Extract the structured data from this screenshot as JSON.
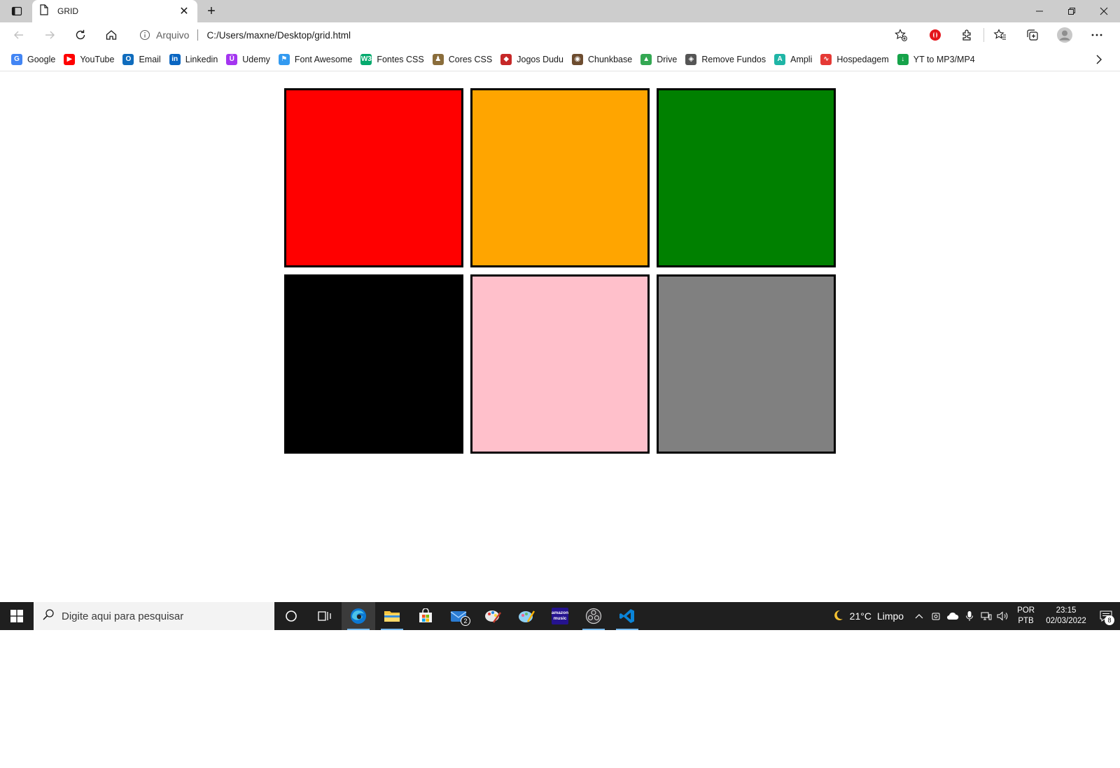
{
  "tab": {
    "title": "GRID"
  },
  "address": {
    "origin_label": "Arquivo",
    "url": "C:/Users/maxne/Desktop/grid.html"
  },
  "bookmarks": [
    {
      "label": "Google",
      "icon": "google-icon",
      "color": "#4285f4",
      "glyph": "G"
    },
    {
      "label": "YouTube",
      "icon": "youtube-icon",
      "color": "#ff0000",
      "glyph": "▶"
    },
    {
      "label": "Email",
      "icon": "outlook-icon",
      "color": "#0f6cbd",
      "glyph": "O"
    },
    {
      "label": "Linkedin",
      "icon": "linkedin-icon",
      "color": "#0a66c2",
      "glyph": "in"
    },
    {
      "label": "Udemy",
      "icon": "udemy-icon",
      "color": "#a435f0",
      "glyph": "Ü"
    },
    {
      "label": "Font Awesome",
      "icon": "flag-icon",
      "color": "#339af0",
      "glyph": "⚑"
    },
    {
      "label": "Fontes CSS",
      "icon": "w3schools-icon",
      "color": "#04aa6d",
      "glyph": "W3"
    },
    {
      "label": "Cores CSS",
      "icon": "paint-icon",
      "color": "#8a6d3b",
      "glyph": "♟"
    },
    {
      "label": "Jogos Dudu",
      "icon": "game-icon",
      "color": "#c62828",
      "glyph": "◆"
    },
    {
      "label": "Chunkbase",
      "icon": "chunkbase-icon",
      "color": "#6d4c2f",
      "glyph": "◉"
    },
    {
      "label": "Drive",
      "icon": "drive-icon",
      "color": "#34a853",
      "glyph": "▲"
    },
    {
      "label": "Remove Fundos",
      "icon": "removebg-icon",
      "color": "#555555",
      "glyph": "◈"
    },
    {
      "label": "Ampli",
      "icon": "ampli-icon",
      "color": "#1fb5a6",
      "glyph": "A"
    },
    {
      "label": "Hospedagem",
      "icon": "hosting-icon",
      "color": "#e53935",
      "glyph": "∿"
    },
    {
      "label": "YT to MP3/MP4",
      "icon": "download-icon",
      "color": "#16a34a",
      "glyph": "↓"
    }
  ],
  "grid_cells": [
    {
      "color": "#ff0000"
    },
    {
      "color": "#ffa500"
    },
    {
      "color": "#008000"
    },
    {
      "color": "#000000"
    },
    {
      "color": "#ffc0cb"
    },
    {
      "color": "#808080"
    }
  ],
  "taskbar": {
    "search_placeholder": "Digite aqui para pesquisar",
    "mail_badge": "2",
    "amazon_music_label": "amazon music"
  },
  "tray": {
    "temperature": "21°C",
    "condition": "Limpo",
    "lang_top": "POR",
    "lang_bottom": "PTB",
    "time": "23:15",
    "date": "02/03/2022",
    "notifications": "8"
  }
}
